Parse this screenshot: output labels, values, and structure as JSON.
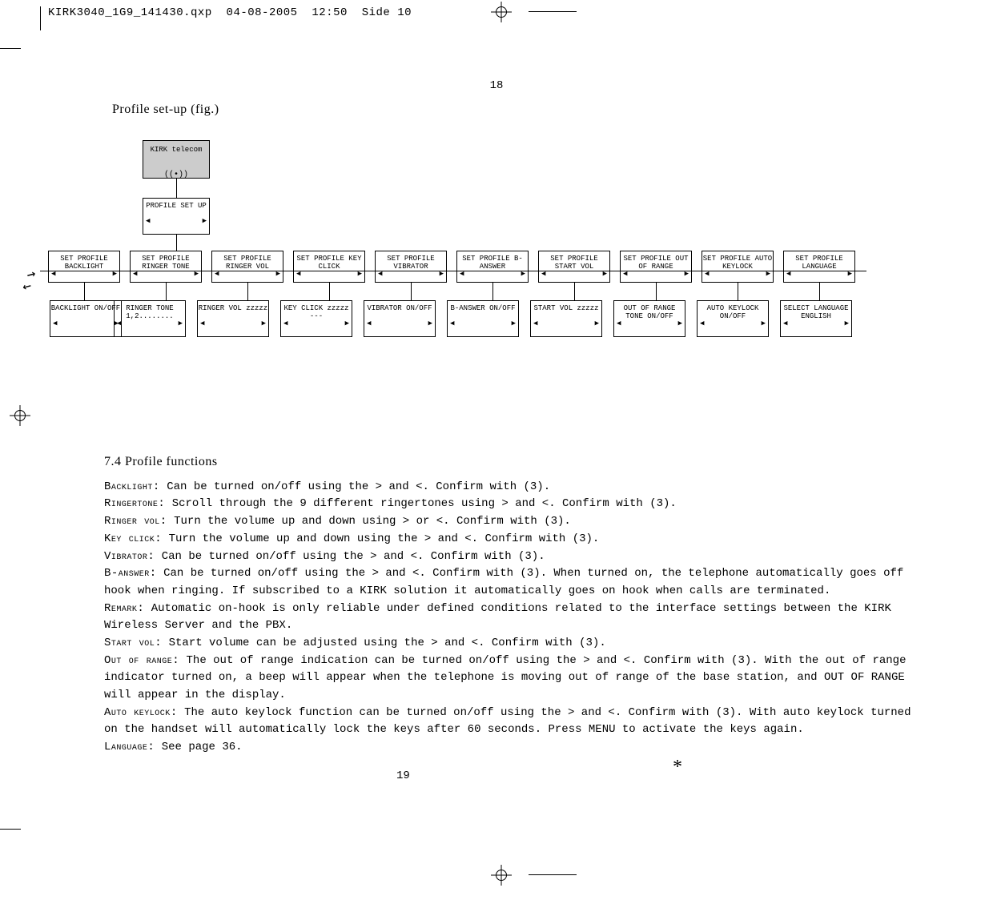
{
  "header": {
    "filename": "KIRK3040_1G9_141430.qxp",
    "date": "04-08-2005",
    "time": "12:50",
    "side": "Side 10"
  },
  "page_num_top": "18",
  "page_num_bottom": "19",
  "subtitle": "Profile set-up (fig.)",
  "diagram": {
    "kirk": "KIRK telecom",
    "profile_setup": "PROFILE SET UP",
    "items": [
      {
        "top": "SET PROFILE BACKLIGHT",
        "bottom": "BACKLIGHT ON/OFF"
      },
      {
        "top": "SET PROFILE RINGER TONE",
        "bottom": "RINGER TONE 1,2........"
      },
      {
        "top": "SET PROFILE RINGER VOL",
        "bottom": "RINGER  VOL zzzzz"
      },
      {
        "top": "SET PROFILE KEY CLICK",
        "bottom": "KEY CLICK zzzzz ---"
      },
      {
        "top": "SET PROFILE VIBRATOR",
        "bottom": "VIBRATOR ON/OFF"
      },
      {
        "top": "SET PROFILE B-ANSWER",
        "bottom": "B-ANSWER ON/OFF"
      },
      {
        "top": "SET PROFILE START VOL",
        "bottom": "START VOL zzzzz"
      },
      {
        "top": "SET PROFILE OUT OF RANGE",
        "bottom": "OUT OF RANGE TONE ON/OFF"
      },
      {
        "top": "SET PROFILE AUTO KEYLOCK",
        "bottom": "AUTO KEYLOCK ON/OFF"
      },
      {
        "top": "SET PROFILE LANGUAGE",
        "bottom": "SELECT LANGUAGE ENGLISH"
      }
    ],
    "nav_left": "◀",
    "nav_right": "▶"
  },
  "text": {
    "section_title": "7.4 Profile functions",
    "backlight_label": "Backlight:",
    "backlight_body": "Can be turned on/off using the > and <. Confirm with (3).",
    "ringertone_label": "Ringertone:",
    "ringertone_body": "Scroll through the 9 different ringertones using > and <. Confirm with (3).",
    "ringervol_label": "Ringer vol:",
    "ringervol_body": "Turn the volume up and down using > or <. Confirm with (3).",
    "keyclick_label": "Key click:",
    "keyclick_body": "Turn the volume up and down using the > and <. Confirm with (3).",
    "vibrator_label": "Vibrator:",
    "vibrator_body": "Can be turned on/off using the > and <. Confirm with (3).",
    "banswer_label": "B-answer:",
    "banswer_body": "Can be turned on/off using the > and <. Confirm with (3). When turned on, the telephone automatically goes off hook when ringing. If subscribed to a KIRK solution it automatically goes on hook when calls are terminated.",
    "remark_label": "Remark:",
    "remark_body": "Automatic on-hook is only reliable under defined conditions related to the interface settings between the KIRK Wireless Server and the PBX.",
    "startvol_label": "Start vol:",
    "startvol_body": "Start volume can be adjusted using the > and <. Confirm with (3).",
    "outofrange_label": "Out of range:",
    "outofrange_body": "The out of range indication can be turned on/off using the > and <. Confirm with (3). With the out of range indicator turned on, a beep will appear when the telephone is moving out of range of the base station, and  OUT OF RANGE  will appear in the display.",
    "autokeylock_label": "Auto keylock:",
    "autokeylock_body": "The auto keylock function can be turned on/off using the > and <. Confirm with (3). With auto keylock turned on the handset will automatically lock the keys after 60 seconds. Press MENU    to activate the keys again.",
    "language_label": "Language:",
    "language_body": "See page 36.",
    "star": "*"
  },
  "signal_icon": "((•))"
}
